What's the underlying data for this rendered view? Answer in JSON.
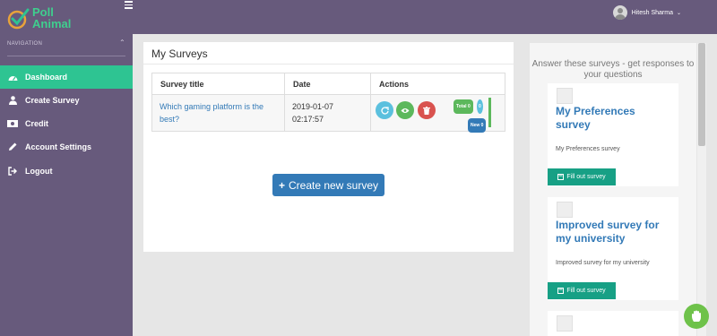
{
  "app": {
    "logo_line1": "Poll",
    "logo_line2": "Animal"
  },
  "sidebar": {
    "heading": "NAVIGATION",
    "items": [
      {
        "label": "Dashboard",
        "icon": "dashboard-icon",
        "active": true
      },
      {
        "label": "Create Survey",
        "icon": "user-icon"
      },
      {
        "label": "Credit",
        "icon": "money-icon"
      },
      {
        "label": "Account Settings",
        "icon": "pencil-icon"
      },
      {
        "label": "Logout",
        "icon": "logout-icon"
      }
    ]
  },
  "header": {
    "user_name": "Hitesh Sharma"
  },
  "main": {
    "title": "My Surveys",
    "columns": [
      "Survey title",
      "Date",
      "Actions"
    ],
    "rows": [
      {
        "title": "Which gaming platform is the best?",
        "date": "2019-01-07 02:17:57",
        "badge_total": "Total 0",
        "badge_count": "0",
        "badge_new": "New 0"
      }
    ],
    "create_button": "Create new survey"
  },
  "right_panel": {
    "heading": "Answer these surveys - get responses to your questions",
    "cards": [
      {
        "title": "My Preferences survey",
        "description": "My Preferences survey",
        "button": "Fill out survey"
      },
      {
        "title": "Improved survey for my university",
        "description": "Improved survey for my university",
        "button": "Fill out survey"
      }
    ]
  },
  "colors": {
    "sidebar": "#675a7c",
    "active_nav": "#2ec492",
    "primary": "#337ab7",
    "fill_button": "#17a085"
  }
}
